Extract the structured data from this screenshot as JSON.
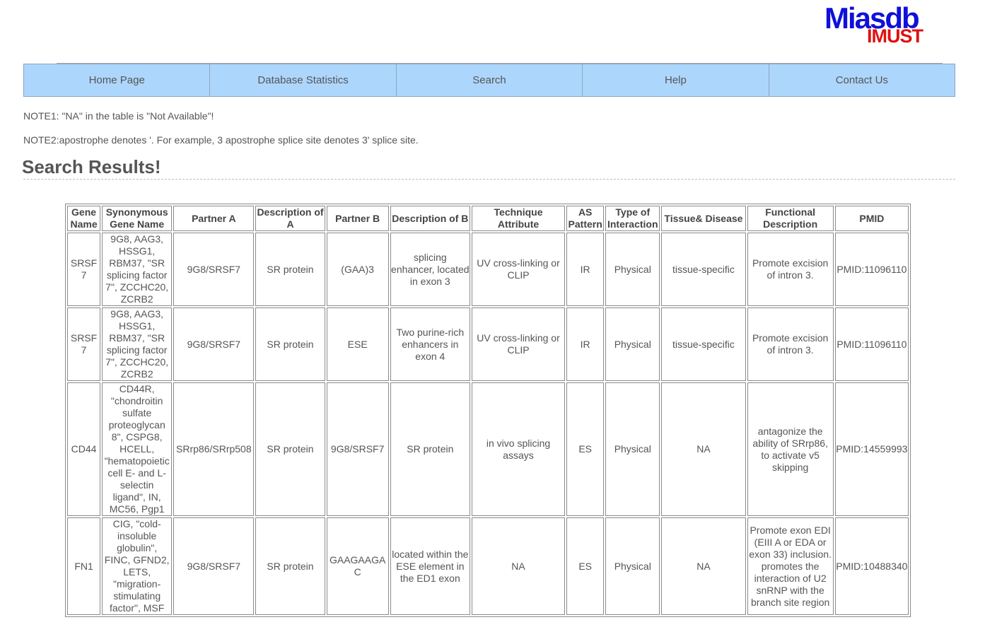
{
  "logo": {
    "top": "Miasdb",
    "bottom": "IMUST"
  },
  "nav": [
    "Home Page",
    "Database Statistics",
    "Search",
    "Help",
    "Contact Us"
  ],
  "notes": {
    "note1": "NOTE1: \"NA\" in the table is \"Not Available\"!",
    "note2": "NOTE2:apostrophe denotes '. For example, 3 apostrophe splice site denotes 3' splice site."
  },
  "heading": "Search Results!",
  "table": {
    "headers": [
      "Gene Name",
      "Synonymous Gene Name",
      "Partner A",
      "Description of A",
      "Partner B",
      "Description of B",
      "Technique Attribute",
      "AS Pattern",
      "Type of Interaction",
      "Tissue& Disease",
      "Functional Description",
      "PMID"
    ],
    "rows": [
      [
        "SRSF7",
        "9G8, AAG3, HSSG1, RBM37, \"SR splicing factor 7\", ZCCHC20, ZCRB2",
        "9G8/SRSF7",
        "SR protein",
        "(GAA)3",
        "splicing enhancer, located in exon 3",
        "UV cross-linking or CLIP",
        "IR",
        "Physical",
        "tissue-specific",
        "Promote excision of intron 3.",
        "PMID:11096110"
      ],
      [
        "SRSF7",
        "9G8, AAG3, HSSG1, RBM37, \"SR splicing factor 7\", ZCCHC20, ZCRB2",
        "9G8/SRSF7",
        "SR protein",
        "ESE",
        "Two purine-rich enhancers in exon 4",
        "UV cross-linking or CLIP",
        "IR",
        "Physical",
        "tissue-specific",
        "Promote excision of intron 3.",
        "PMID:11096110"
      ],
      [
        "CD44",
        "CD44R, \"chondroitin sulfate proteoglycan 8\", CSPG8, HCELL, \"hematopoietic cell E- and L-selectin ligand\", IN, MC56, Pgp1",
        "SRrp86/SRrp508",
        "SR protein",
        "9G8/SRSF7",
        "SR protein",
        "in vivo splicing assays",
        "ES",
        "Physical",
        "NA",
        "antagonize the ability of SRrp86, to activate v5 skipping",
        "PMID:14559993"
      ],
      [
        "FN1",
        "CIG, \"cold-insoluble globulin\", FINC, GFND2, LETS, \"migration-stimulating factor\", MSF",
        "9G8/SRSF7",
        "SR protein",
        "GAAGAAGAC",
        "located within the ESE element in the ED1 exon",
        "NA",
        "ES",
        "Physical",
        "NA",
        "Promote exon EDI (EIII A or EDA or exon 33) inclusion. promotes the interaction of U2 snRNP with the branch site region",
        "PMID:10488340"
      ]
    ]
  }
}
